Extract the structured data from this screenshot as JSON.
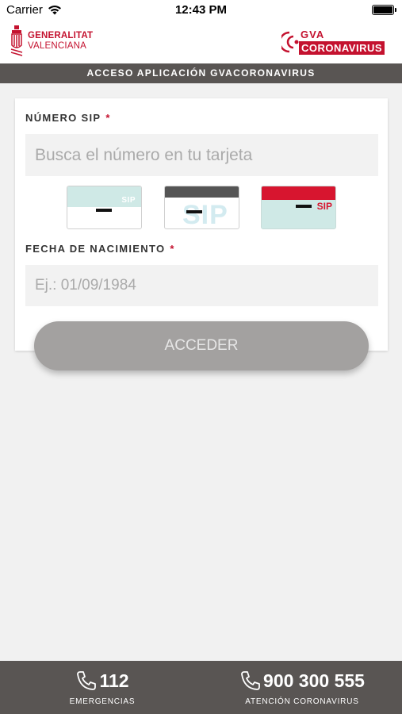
{
  "status_bar": {
    "carrier": "Carrier",
    "time": "12:43 PM"
  },
  "header": {
    "left_logo": {
      "line1": "GENERALITAT",
      "line2": "VALENCIANA"
    },
    "right_logo": {
      "line1": "GVA",
      "line2": "CORONAVIRUS"
    }
  },
  "title_bar": {
    "text": "ACCESO APLICACIÓN GVACORONAVIRUS"
  },
  "form": {
    "sip_label": "NÚMERO SIP",
    "required_mark": "*",
    "sip_placeholder": "Busca el número en tu tarjeta",
    "sip_value": "",
    "dob_label": "FECHA DE NACIMIENTO",
    "dob_placeholder": "Ej.: 01/09/1984",
    "dob_value": "",
    "card_examples": [
      {
        "label": "SIP"
      },
      {
        "label": "SIP"
      },
      {
        "label": "SIP"
      }
    ],
    "submit_label": "ACCEDER"
  },
  "footer": {
    "left": {
      "number": "112",
      "label": "EMERGENCIAS",
      "icon": "phone-icon"
    },
    "right": {
      "number": "900 300 555",
      "label": "ATENCIÓN CORONAVIRUS",
      "icon": "phone-icon"
    }
  },
  "colors": {
    "brand_red": "#c4122f",
    "bar_gray": "#595553",
    "button_gray": "#a3a1a0",
    "background": "#f1f1f1"
  }
}
